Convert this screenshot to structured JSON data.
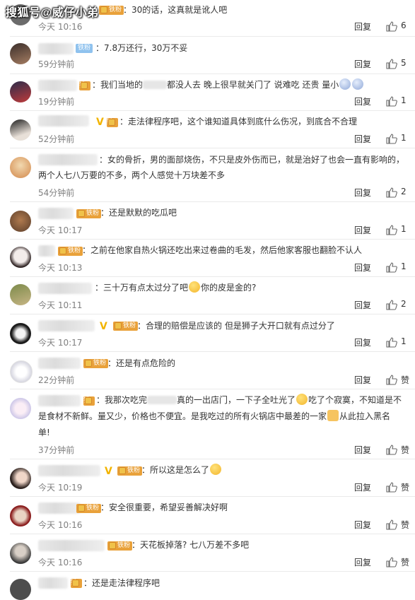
{
  "watermark": "搜狐号@威仔小弟",
  "ui": {
    "reply_label": "回复",
    "like_label": "赞"
  },
  "badges": {
    "fan": "铁粉"
  },
  "comments": [
    {
      "text": "：30的话，这真就是讹人吧",
      "time": "今天 10:16",
      "likes": "6"
    },
    {
      "text": "：7.8万还行，30万不妥",
      "time": "59分钟前",
      "likes": "5"
    },
    {
      "text_a": "：我们当地的",
      "text_b": "都没人去  晚上很早就关门了  说难吃  还贵  量小",
      "time": "19分钟前",
      "likes": "1"
    },
    {
      "text": "：走法律程序吧，这个谁知道具体到底什么伤况，到底合不合理",
      "time": "52分钟前",
      "likes": "1"
    },
    {
      "text_1": "：女的骨折，男的面部烧伤，不只是皮外伤而已，就是治好了也会一直有影响的，",
      "text_2": "两个人七八万要的不多，两个人感觉十万块差不多",
      "time": "54分钟前",
      "likes": "2"
    },
    {
      "text": "：还是默默的吃瓜吧",
      "time": "今天 10:17",
      "likes": "1"
    },
    {
      "text": "：之前在他家自热火锅还吃出来过卷曲的毛发，然后他家客服也翻脸不认人",
      "time": "今天 10:13",
      "likes": "1"
    },
    {
      "text_a": "：三十万有点太过分了吧",
      "text_b": "你的皮是金的?",
      "time": "今天 10:11",
      "likes": "2"
    },
    {
      "text": "：合理的赔偿是应该的  但是狮子大开口就有点过分了",
      "time": "今天 10:17",
      "likes": "1"
    },
    {
      "text": "：还是有点危险的",
      "time": "22分钟前",
      "likes": ""
    },
    {
      "text_1a": "：我那次吃完",
      "text_1b": "真的一出店门，一下子全吐光了",
      "text_1c": "吃了个寂寞，不知道是不",
      "text_2a": "是食材不新鲜。量又少，价格也不便宜。是我吃过的所有火锅店中最差的一家",
      "text_2b": "从此拉入黑名",
      "text_3": "单!",
      "time": "37分钟前",
      "likes": ""
    },
    {
      "text": "：所以这是怎么了",
      "time": "今天 10:19",
      "likes": ""
    },
    {
      "text": "：安全很重要，希望妥善解决好啊",
      "time": "今天 10:16",
      "likes": ""
    },
    {
      "text": "：天花板掉落? 七八万差不多吧",
      "time": "今天 10:16",
      "likes": ""
    },
    {
      "text": "：还是走法律程序吧",
      "time": "",
      "likes": ""
    }
  ]
}
